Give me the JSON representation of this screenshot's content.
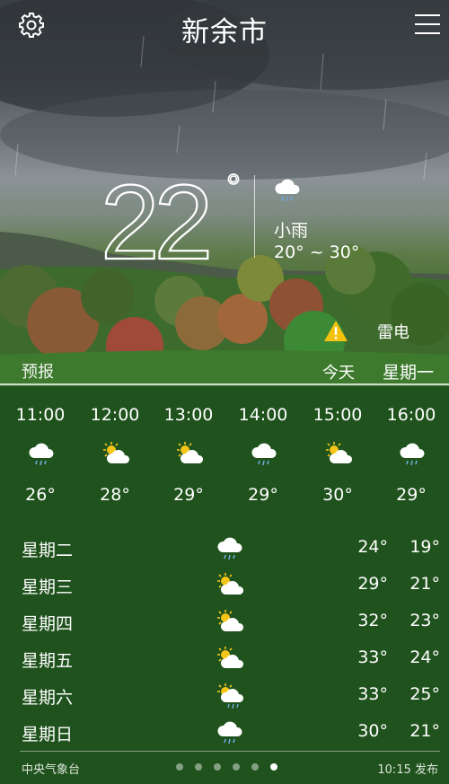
{
  "header": {
    "city": "新余市"
  },
  "current": {
    "temperature": "22",
    "degree_symbol": "°",
    "condition": "小雨",
    "range": "20° ~ 30°",
    "alert": "雷电"
  },
  "labels": {
    "forecast": "预报",
    "today": "今天",
    "weekday": "星期一"
  },
  "hourly": [
    {
      "time": "11:00",
      "icon": "rain-cloud-icon",
      "temp": "26°"
    },
    {
      "time": "12:00",
      "icon": "partly-cloudy-icon",
      "temp": "28°"
    },
    {
      "time": "13:00",
      "icon": "partly-cloudy-icon",
      "temp": "29°"
    },
    {
      "time": "14:00",
      "icon": "rain-cloud-icon",
      "temp": "29°"
    },
    {
      "time": "15:00",
      "icon": "partly-cloudy-icon",
      "temp": "30°"
    },
    {
      "time": "16:00",
      "icon": "rain-cloud-icon",
      "temp": "29°"
    }
  ],
  "daily": [
    {
      "day": "星期二",
      "icon": "rain-cloud-icon",
      "high": "24°",
      "low": "19°"
    },
    {
      "day": "星期三",
      "icon": "partly-cloudy-icon",
      "high": "29°",
      "low": "21°"
    },
    {
      "day": "星期四",
      "icon": "partly-cloudy-icon",
      "high": "32°",
      "low": "23°"
    },
    {
      "day": "星期五",
      "icon": "partly-cloudy-icon",
      "high": "33°",
      "low": "24°"
    },
    {
      "day": "星期六",
      "icon": "sun-rain-cloud-icon",
      "high": "33°",
      "low": "25°"
    },
    {
      "day": "星期日",
      "icon": "rain-cloud-icon",
      "high": "30°",
      "low": "21°"
    }
  ],
  "footer": {
    "source": "中央气象台",
    "published": "10:15 发布",
    "page_count": 6,
    "active_page": 6
  },
  "colors": {
    "panel_green": "#1f521c",
    "sun_yellow": "#f5c518",
    "alert_yellow": "#f4c20d"
  }
}
